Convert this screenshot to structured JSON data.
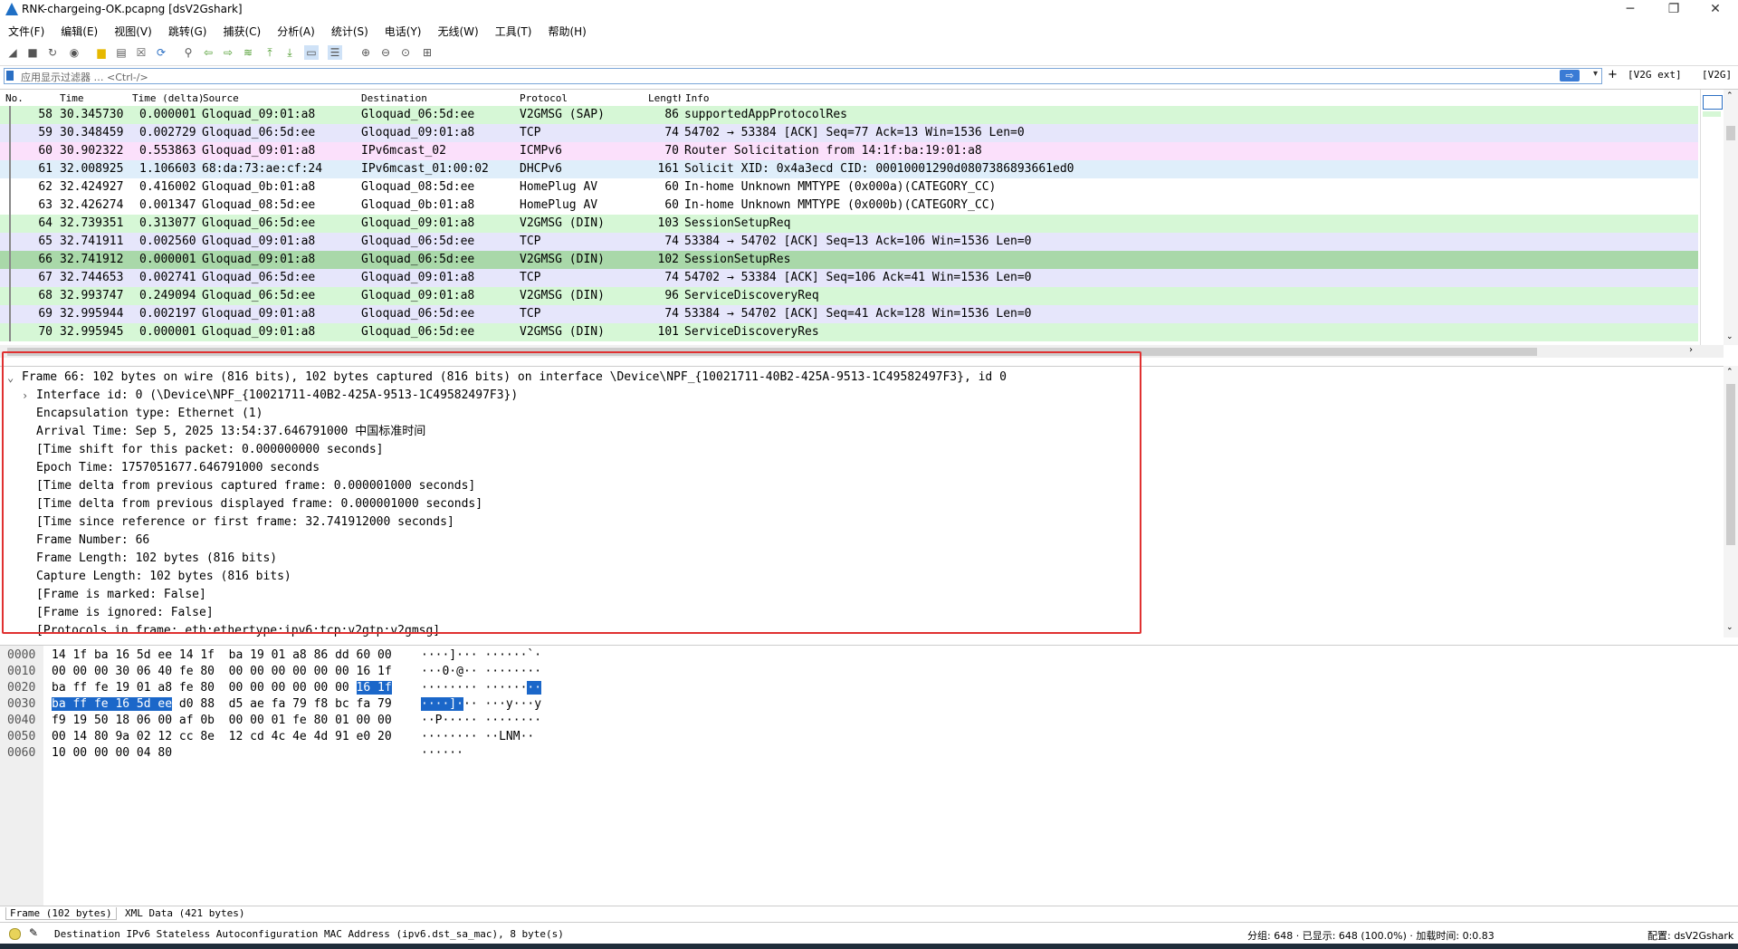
{
  "window": {
    "title": "RNK-chargeing-OK.pcapng [dsV2Gshark]",
    "minimize": "─",
    "restore": "❐",
    "close": "✕"
  },
  "menu": [
    "文件(F)",
    "编辑(E)",
    "视图(V)",
    "跳转(G)",
    "捕获(C)",
    "分析(A)",
    "统计(S)",
    "电话(Y)",
    "无线(W)",
    "工具(T)",
    "帮助(H)"
  ],
  "toolbar_icons": [
    "shark-fin-start-icon",
    "stop-icon",
    "restart-icon",
    "options-gear-icon",
    "open-file-icon",
    "save-file-icon",
    "close-file-icon",
    "reload-icon",
    "find-icon",
    "go-back-icon",
    "go-forward-icon",
    "go-to-packet-icon",
    "go-first-icon",
    "go-last-icon",
    "auto-scroll-icon",
    "colorize-icon",
    "zoom-in-icon",
    "zoom-out-icon",
    "zoom-normal-icon",
    "resize-columns-icon"
  ],
  "filter": {
    "placeholder": "应用显示过滤器 … <Ctrl-/>",
    "apply": "⇨",
    "dropdown": "▾",
    "add": "+",
    "btn_v2g_ext": "[V2G ext]",
    "btn_v2g": "[V2G]"
  },
  "packet_list": {
    "columns": {
      "no": "No.",
      "time": "Time",
      "delta": "Time (delta)",
      "src": "Source",
      "dst": "Destination",
      "proto": "Protocol",
      "len": "Length",
      "info": "Info"
    },
    "rows": [
      {
        "no": "58",
        "time": "30.345730",
        "delta": "0.000001",
        "src": "Gloquad_09:01:a8",
        "dst": "Gloquad_06:5d:ee",
        "proto": "V2GMSG (SAP)",
        "len": "86",
        "info": "supportedAppProtocolRes",
        "color": "v2g"
      },
      {
        "no": "59",
        "time": "30.348459",
        "delta": "0.002729",
        "src": "Gloquad_06:5d:ee",
        "dst": "Gloquad_09:01:a8",
        "proto": "TCP",
        "len": "74",
        "info": "54702 → 53384 [ACK] Seq=77 Ack=13 Win=1536 Len=0",
        "color": "tcp"
      },
      {
        "no": "60",
        "time": "30.902322",
        "delta": "0.553863",
        "src": "Gloquad_09:01:a8",
        "dst": "IPv6mcast_02",
        "proto": "ICMPv6",
        "len": "70",
        "info": "Router Solicitation from 14:1f:ba:19:01:a8",
        "color": "icmp"
      },
      {
        "no": "61",
        "time": "32.008925",
        "delta": "1.106603",
        "src": "68:da:73:ae:cf:24",
        "dst": "IPv6mcast_01:00:02",
        "proto": "DHCPv6",
        "len": "161",
        "info": "Solicit XID: 0x4a3ecd CID: 00010001290d0807386893661ed0",
        "color": "dhcp"
      },
      {
        "no": "62",
        "time": "32.424927",
        "delta": "0.416002",
        "src": "Gloquad_0b:01:a8",
        "dst": "Gloquad_08:5d:ee",
        "proto": "HomePlug AV",
        "len": "60",
        "info": "In-home Unknown MMTYPE (0x000a)(CATEGORY_CC)",
        "color": "white"
      },
      {
        "no": "63",
        "time": "32.426274",
        "delta": "0.001347",
        "src": "Gloquad_08:5d:ee",
        "dst": "Gloquad_0b:01:a8",
        "proto": "HomePlug AV",
        "len": "60",
        "info": "In-home Unknown MMTYPE (0x000b)(CATEGORY_CC)",
        "color": "white"
      },
      {
        "no": "64",
        "time": "32.739351",
        "delta": "0.313077",
        "src": "Gloquad_06:5d:ee",
        "dst": "Gloquad_09:01:a8",
        "proto": "V2GMSG (DIN)",
        "len": "103",
        "info": "SessionSetupReq",
        "color": "v2g"
      },
      {
        "no": "65",
        "time": "32.741911",
        "delta": "0.002560",
        "src": "Gloquad_09:01:a8",
        "dst": "Gloquad_06:5d:ee",
        "proto": "TCP",
        "len": "74",
        "info": "53384 → 54702 [ACK] Seq=13 Ack=106 Win=1536 Len=0",
        "color": "tcp"
      },
      {
        "no": "66",
        "time": "32.741912",
        "delta": "0.000001",
        "src": "Gloquad_09:01:a8",
        "dst": "Gloquad_06:5d:ee",
        "proto": "V2GMSG (DIN)",
        "len": "102",
        "info": "SessionSetupRes",
        "color": "sel"
      },
      {
        "no": "67",
        "time": "32.744653",
        "delta": "0.002741",
        "src": "Gloquad_06:5d:ee",
        "dst": "Gloquad_09:01:a8",
        "proto": "TCP",
        "len": "74",
        "info": "54702 → 53384 [ACK] Seq=106 Ack=41 Win=1536 Len=0",
        "color": "tcp"
      },
      {
        "no": "68",
        "time": "32.993747",
        "delta": "0.249094",
        "src": "Gloquad_06:5d:ee",
        "dst": "Gloquad_09:01:a8",
        "proto": "V2GMSG (DIN)",
        "len": "96",
        "info": "ServiceDiscoveryReq",
        "color": "v2g"
      },
      {
        "no": "69",
        "time": "32.995944",
        "delta": "0.002197",
        "src": "Gloquad_09:01:a8",
        "dst": "Gloquad_06:5d:ee",
        "proto": "TCP",
        "len": "74",
        "info": "53384 → 54702 [ACK] Seq=41 Ack=128 Win=1536 Len=0",
        "color": "tcp"
      },
      {
        "no": "70",
        "time": "32.995945",
        "delta": "0.000001",
        "src": "Gloquad_09:01:a8",
        "dst": "Gloquad_06:5d:ee",
        "proto": "V2GMSG (DIN)",
        "len": "101",
        "info": "ServiceDiscoveryRes",
        "color": "v2g"
      }
    ]
  },
  "details": {
    "rows": [
      {
        "exp": "⌄",
        "text": "Frame 66: 102 bytes on wire (816 bits), 102 bytes captured (816 bits) on interface \\Device\\NPF_{10021711-40B2-425A-9513-1C49582497F3}, id 0"
      },
      {
        "exp": "›",
        "text": "Interface id: 0 (\\Device\\NPF_{10021711-40B2-425A-9513-1C49582497F3})"
      },
      {
        "exp": "",
        "text": "Encapsulation type: Ethernet (1)"
      },
      {
        "exp": "",
        "text": "Arrival Time: Sep  5, 2025 13:54:37.646791000 中国标准时间"
      },
      {
        "exp": "",
        "text": "[Time shift for this packet: 0.000000000 seconds]"
      },
      {
        "exp": "",
        "text": "Epoch Time: 1757051677.646791000 seconds"
      },
      {
        "exp": "",
        "text": "[Time delta from previous captured frame: 0.000001000 seconds]"
      },
      {
        "exp": "",
        "text": "[Time delta from previous displayed frame: 0.000001000 seconds]"
      },
      {
        "exp": "",
        "text": "[Time since reference or first frame: 32.741912000 seconds]"
      },
      {
        "exp": "",
        "text": "Frame Number: 66"
      },
      {
        "exp": "",
        "text": "Frame Length: 102 bytes (816 bits)"
      },
      {
        "exp": "",
        "text": "Capture Length: 102 bytes (816 bits)"
      },
      {
        "exp": "",
        "text": "[Frame is marked: False]"
      },
      {
        "exp": "",
        "text": "[Frame is ignored: False]"
      },
      {
        "exp": "",
        "text": "[Protocols in frame: eth:ethertype:ipv6:tcp:v2gtp:v2gmsg]"
      }
    ]
  },
  "bytes": {
    "rows": [
      {
        "off": "0000",
        "hex_a": "14 1f ba 16 5d ee 14 1f  ba 19 01 a8 86 dd 60 00",
        "hex_hl": "",
        "hex_b": "",
        "asc_a": "····]··· ······`·",
        "asc_hl": "",
        "asc_b": ""
      },
      {
        "off": "0010",
        "hex_a": "00 00 00 30 06 40 fe 80  00 00 00 00 00 00 16 1f",
        "hex_hl": "",
        "hex_b": "",
        "asc_a": "···0·@·· ········",
        "asc_hl": "",
        "asc_b": ""
      },
      {
        "off": "0020",
        "hex_a": "ba ff fe 19 01 a8 fe 80  00 00 00 00 00 00 ",
        "hex_hl": "16 1f",
        "hex_b": "",
        "asc_a": "········ ······",
        "asc_hl": "··",
        "asc_b": ""
      },
      {
        "off": "0030",
        "hex_a": "",
        "hex_hl": "ba ff fe 16 5d ee",
        "hex_b": " d0 88  d5 ae fa 79 f8 bc fa 79",
        "asc_a": "",
        "asc_hl": "····]·",
        "asc_b": "·· ···y···y"
      },
      {
        "off": "0040",
        "hex_a": "f9 19 50 18 06 00 af 0b  00 00 01 fe 80 01 00 00",
        "hex_hl": "",
        "hex_b": "",
        "asc_a": "··P····· ········",
        "asc_hl": "",
        "asc_b": ""
      },
      {
        "off": "0050",
        "hex_a": "00 14 80 9a 02 12 cc 8e  12 cd 4c 4e 4d 91 e0 20",
        "hex_hl": "",
        "hex_b": "",
        "asc_a": "········ ··LNM··",
        "asc_hl": "",
        "asc_b": ""
      },
      {
        "off": "0060",
        "hex_a": "10 00 00 00 04 80",
        "hex_hl": "",
        "hex_b": "",
        "asc_a": "······",
        "asc_hl": "",
        "asc_b": ""
      }
    ],
    "tabs": [
      "Frame (102 bytes)",
      "XML Data (421 bytes)"
    ]
  },
  "status": {
    "field": "Destination IPv6 Stateless Autoconfiguration MAC Address (ipv6.dst_sa_mac), 8 byte(s)",
    "packets": "分组: 648 · 已显示: 648 (100.0%) · 加载时间: 0:0.83",
    "profile": "配置: dsV2Gshark"
  },
  "colors": {
    "v2g": "#d6f7d6",
    "tcp": "#e6e6fb",
    "icmp": "#fbe0fb",
    "dhcp": "#dfeefa",
    "selected": "#a9d8a9",
    "highlight": "#1b67c9",
    "annotation_box": "#e03131"
  }
}
